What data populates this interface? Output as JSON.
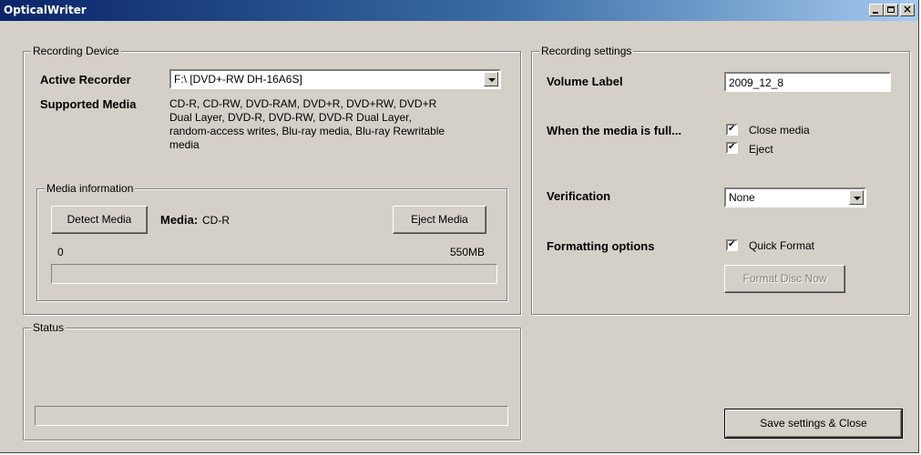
{
  "window": {
    "title": "OpticalWriter"
  },
  "titlebar_buttons": {
    "minimize": "minimize-icon",
    "maximize": "maximize-icon",
    "close": "close-icon"
  },
  "recording_device": {
    "group_title": "Recording Device",
    "active_recorder_label": "Active Recorder",
    "active_recorder_value": "F:\\ [DVD+-RW DH-16A6S]",
    "supported_media_label": "Supported Media",
    "supported_media_lines": [
      "CD-R, CD-RW, DVD-RAM, DVD+R, DVD+RW, DVD+R",
      "Dual Layer, DVD-R, DVD-RW, DVD-R Dual Layer,",
      "random-access writes, Blu-ray media, Blu-ray Rewritable",
      "media"
    ],
    "media_information": {
      "group_title": "Media information",
      "detect_button": "Detect Media",
      "media_label": "Media:",
      "media_value": "CD-R",
      "eject_button": "Eject Media",
      "min_label": "0",
      "max_label": "550MB",
      "progress": 0
    }
  },
  "status": {
    "group_title": "Status",
    "progress": 0
  },
  "recording_settings": {
    "group_title": "Recording settings",
    "volume_label": "Volume Label",
    "volume_value": "2009_12_8",
    "when_full_label": "When the media is full...",
    "close_media_label": "Close media",
    "close_media_checked": true,
    "eject_label": "Eject",
    "eject_checked": true,
    "verification_label": "Verification",
    "verification_value": "None",
    "formatting_label": "Formatting options",
    "quick_format_label": "Quick Format",
    "quick_format_checked": true,
    "format_now_button": "Format Disc Now"
  },
  "save_button": "Save settings & Close"
}
